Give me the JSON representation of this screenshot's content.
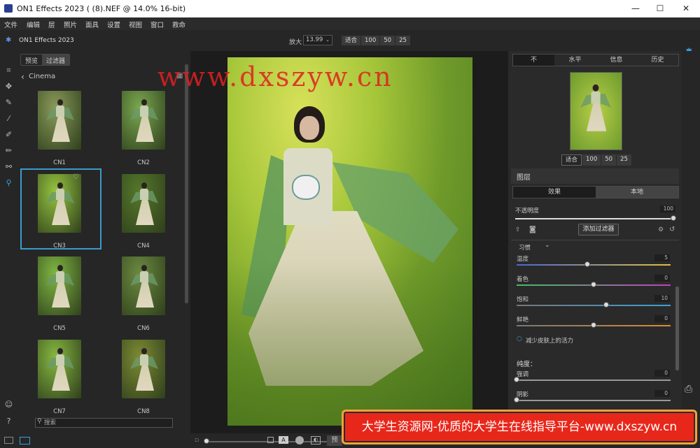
{
  "window": {
    "title": "ON1 Effects 2023 ( (8).NEF @ 14.0% 16-bit)",
    "min": "—",
    "max": "☐",
    "close": "✕"
  },
  "menu": [
    "文件",
    "编辑",
    "层",
    "照片",
    "面具",
    "设置",
    "视图",
    "窗口",
    "救命"
  ],
  "toolbar": {
    "app_name": "ON1 Effects 2023",
    "zoom_label": "放大",
    "zoom_value": "13.99",
    "fit": [
      "适合",
      "100",
      "50",
      "25"
    ]
  },
  "browser": {
    "tabs": [
      "预览",
      "过滤器"
    ],
    "category": "Cinema",
    "thumbs": [
      {
        "label": "CN1",
        "tone": "#8a9a5a"
      },
      {
        "label": "CN2",
        "tone": "#7aa850"
      },
      {
        "label": "CN3",
        "tone": "#95c43e"
      },
      {
        "label": "CN4",
        "tone": "#55782a"
      },
      {
        "label": "CN5",
        "tone": "#7fb742"
      },
      {
        "label": "CN6",
        "tone": "#6b8a40"
      },
      {
        "label": "CN7",
        "tone": "#86b840"
      },
      {
        "label": "CN8",
        "tone": "#7c8a33"
      }
    ],
    "search_placeholder": "搜索"
  },
  "watermark": "www.dxszyw.cn",
  "right": {
    "tabs": [
      "不",
      "水平",
      "信息",
      "历史"
    ],
    "nav_fit": [
      "适合",
      "100",
      "50",
      "25"
    ],
    "layers_title": "图层",
    "layer_tabs": [
      "效果",
      "本地"
    ],
    "opacity_label": "不透明度",
    "opacity_value": "100",
    "add_filter": "添加过滤器",
    "habit_label": "习惯",
    "sliders": [
      {
        "label": "温度",
        "value": "5",
        "pos": 0.46
      },
      {
        "label": "着色",
        "value": "0",
        "pos": 0.5
      },
      {
        "label": "饱和",
        "value": "10",
        "pos": 0.58
      },
      {
        "label": "鲜艳",
        "value": "0",
        "pos": 0.5
      }
    ],
    "reduce_skin": "减少皮肤上的活力",
    "clarity_title": "纯度：",
    "clarity_sliders": [
      {
        "label": "强调",
        "value": "0",
        "pos": 0
      },
      {
        "label": "阴影",
        "value": "0",
        "pos": 0
      }
    ]
  },
  "bottom": {
    "button": "预"
  },
  "banner": "大学生资源网-优质的大学生在线指导平台-www.dxszyw.cn"
}
